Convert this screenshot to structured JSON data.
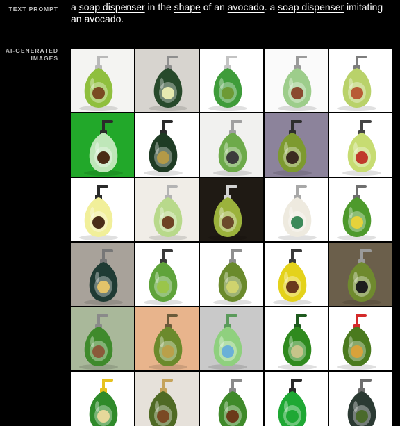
{
  "labels": {
    "prompt": "TEXT PROMPT",
    "images": "AI-GENERATED IMAGES"
  },
  "prompt": [
    {
      "text": "a ",
      "link": false
    },
    {
      "text": "soap dispenser",
      "link": true
    },
    {
      "text": " in the ",
      "link": false
    },
    {
      "text": "shape",
      "link": true
    },
    {
      "text": " of an ",
      "link": false
    },
    {
      "text": "avocado",
      "link": true
    },
    {
      "text": ". a ",
      "link": false
    },
    {
      "text": "soap dispenser",
      "link": true
    },
    {
      "text": " imitating an ",
      "link": false
    },
    {
      "text": "avocado",
      "link": true
    },
    {
      "text": ".",
      "link": false
    }
  ],
  "tiles": [
    {
      "bg": "#f4f4f2",
      "body": "#8fbf3e",
      "pit": "#7a4a22",
      "pump": "#b9b9b9"
    },
    {
      "bg": "#d7d4cf",
      "body": "#27492b",
      "pit": "#e6eab0",
      "pump": "#8e8e8e"
    },
    {
      "bg": "#ffffff",
      "body": "#3f9c3a",
      "pit": "#6d9a35",
      "pump": "#c3c3c3"
    },
    {
      "bg": "#fafafa",
      "body": "#9dcd8b",
      "pit": "#8a4a2f",
      "pump": "#9a9a9a"
    },
    {
      "bg": "#ffffff",
      "body": "#b9d26a",
      "pit": "#b85b35",
      "pump": "#7d7d7d"
    },
    {
      "bg": "#22a82a",
      "body": "#bfe7b9",
      "pit": "#4a2c16",
      "pump": "#2b2b2b"
    },
    {
      "bg": "#ffffff",
      "body": "#1f3c24",
      "pit": "#b49a47",
      "pump": "#2b2b2b"
    },
    {
      "bg": "#f1f1ef",
      "body": "#6daa4a",
      "pit": "#3b3b3b",
      "pump": "#a0a0a0"
    },
    {
      "bg": "#8c839b",
      "body": "#7d9a2f",
      "pit": "#3a2a20",
      "pump": "#2e2e2e"
    },
    {
      "bg": "#ffffff",
      "body": "#c7dc72",
      "pit": "#c0392b",
      "pump": "#444444"
    },
    {
      "bg": "#ffffff",
      "body": "#f1ef9a",
      "pit": "#4a2d18",
      "pump": "#2a2a2a"
    },
    {
      "bg": "#f0ede7",
      "body": "#b8d98b",
      "pit": "#6f4325",
      "pump": "#b3b3b3"
    },
    {
      "bg": "#1f1a14",
      "body": "#9bb23c",
      "pit": "#6b4a2a",
      "pump": "#d2d2d2"
    },
    {
      "bg": "#ffffff",
      "body": "#eeeadf",
      "pit": "#3c8a5a",
      "pump": "#a8a8a8"
    },
    {
      "bg": "#ffffff",
      "body": "#4e9a2c",
      "pit": "#e6d23a",
      "pump": "#6e6e6e"
    },
    {
      "bg": "#a8a29a",
      "body": "#1f3b34",
      "pit": "#e2c36a",
      "pump": "#777777"
    },
    {
      "bg": "#ffffff",
      "body": "#5fa33a",
      "pit": "#9ac54a",
      "pump": "#3a3a3a"
    },
    {
      "bg": "#ffffff",
      "body": "#6a8a2c",
      "pit": "#cfd36e",
      "pump": "#8f8f8f"
    },
    {
      "bg": "#ffffff",
      "body": "#e4d21b",
      "pit": "#6a3a1c",
      "pump": "#3a3a3a"
    },
    {
      "bg": "#6b5f4b",
      "body": "#6f8a2e",
      "pit": "#1d1d1d",
      "pump": "#9a9a9a"
    },
    {
      "bg": "#a9b89a",
      "body": "#3f8a2c",
      "pit": "#8a5a3a",
      "pump": "#8a8a8a"
    },
    {
      "bg": "#e8b48c",
      "body": "#6b8a2c",
      "pit": "#b9a04a",
      "pump": "#6a5a3a"
    },
    {
      "bg": "#c9c9c9",
      "body": "#8fd07e",
      "pit": "#6ab0d8",
      "pump": "#5a9a5a"
    },
    {
      "bg": "#ffffff",
      "body": "#2f8a1e",
      "pit": "#c7c48a",
      "pump": "#1e5a1e"
    },
    {
      "bg": "#ffffff",
      "body": "#4a7a1e",
      "pit": "#d9a23a",
      "pump": "#d42a2a"
    },
    {
      "bg": "#ffffff",
      "body": "#2f8a2a",
      "pit": "#e6d89a",
      "pump": "#e6c21e"
    },
    {
      "bg": "#e6e1da",
      "body": "#4f6a24",
      "pit": "#7a4a24",
      "pump": "#c5a35a"
    },
    {
      "bg": "#ffffff",
      "body": "#3f8a2a",
      "pit": "#6b3a1a",
      "pump": "#8a8a8a"
    },
    {
      "bg": "#ffffff",
      "body": "#1fa834",
      "pit": "#1fa834",
      "pump": "#2a2a2a"
    },
    {
      "bg": "#ffffff",
      "body": "#2b3a33",
      "pit": "#4a6a2a",
      "pump": "#6e6e6e"
    }
  ]
}
